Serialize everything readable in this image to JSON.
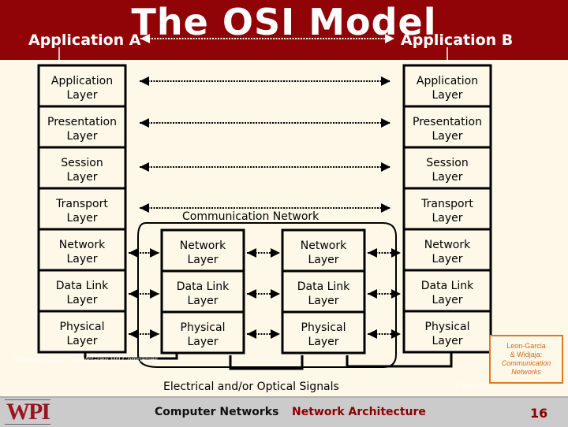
{
  "header": {
    "title": "The OSI Model",
    "app_a": "Application A",
    "app_b": "Application B"
  },
  "end_stack_a": [
    {
      "line1": "Application",
      "line2": "Layer"
    },
    {
      "line1": "Presentation",
      "line2": "Layer"
    },
    {
      "line1": "Session",
      "line2": "Layer"
    },
    {
      "line1": "Transport",
      "line2": "Layer"
    },
    {
      "line1": "Network",
      "line2": "Layer"
    },
    {
      "line1": "Data Link",
      "line2": "Layer"
    },
    {
      "line1": "Physical",
      "line2": "Layer"
    }
  ],
  "end_stack_b": [
    {
      "line1": "Application",
      "line2": "Layer"
    },
    {
      "line1": "Presentation",
      "line2": "Layer"
    },
    {
      "line1": "Session",
      "line2": "Layer"
    },
    {
      "line1": "Transport",
      "line2": "Layer"
    },
    {
      "line1": "Network",
      "line2": "Layer"
    },
    {
      "line1": "Data Link",
      "line2": "Layer"
    },
    {
      "line1": "Physical",
      "line2": "Layer"
    }
  ],
  "relay_1": [
    {
      "line1": "Network",
      "line2": "Layer"
    },
    {
      "line1": "Data Link",
      "line2": "Layer"
    },
    {
      "line1": "Physical",
      "line2": "Layer"
    }
  ],
  "relay_2": [
    {
      "line1": "Network",
      "line2": "Layer"
    },
    {
      "line1": "Data Link",
      "line2": "Layer"
    },
    {
      "line1": "Physical",
      "line2": "Layer"
    }
  ],
  "network_label": "Communication Network",
  "signals_label": "Electrical and/or Optical Signals",
  "watermark": "Copyright ©2000 The McGraw Hill Companies",
  "figure_label": "Figure 2.6",
  "credit": {
    "line1": "Leon-Garcia",
    "line2": "& Widjaja:",
    "line3": "Communication",
    "line4": "Networks"
  },
  "footer": {
    "logo": "WPI",
    "course": "Computer Networks",
    "topic": "Network Architecture",
    "page": "16"
  },
  "colors": {
    "header_bg": "#900408",
    "background": "#fdf8e8",
    "footer_bg": "#cbcbcb",
    "accent": "#8b0000",
    "credit_border": "#e07a22"
  }
}
